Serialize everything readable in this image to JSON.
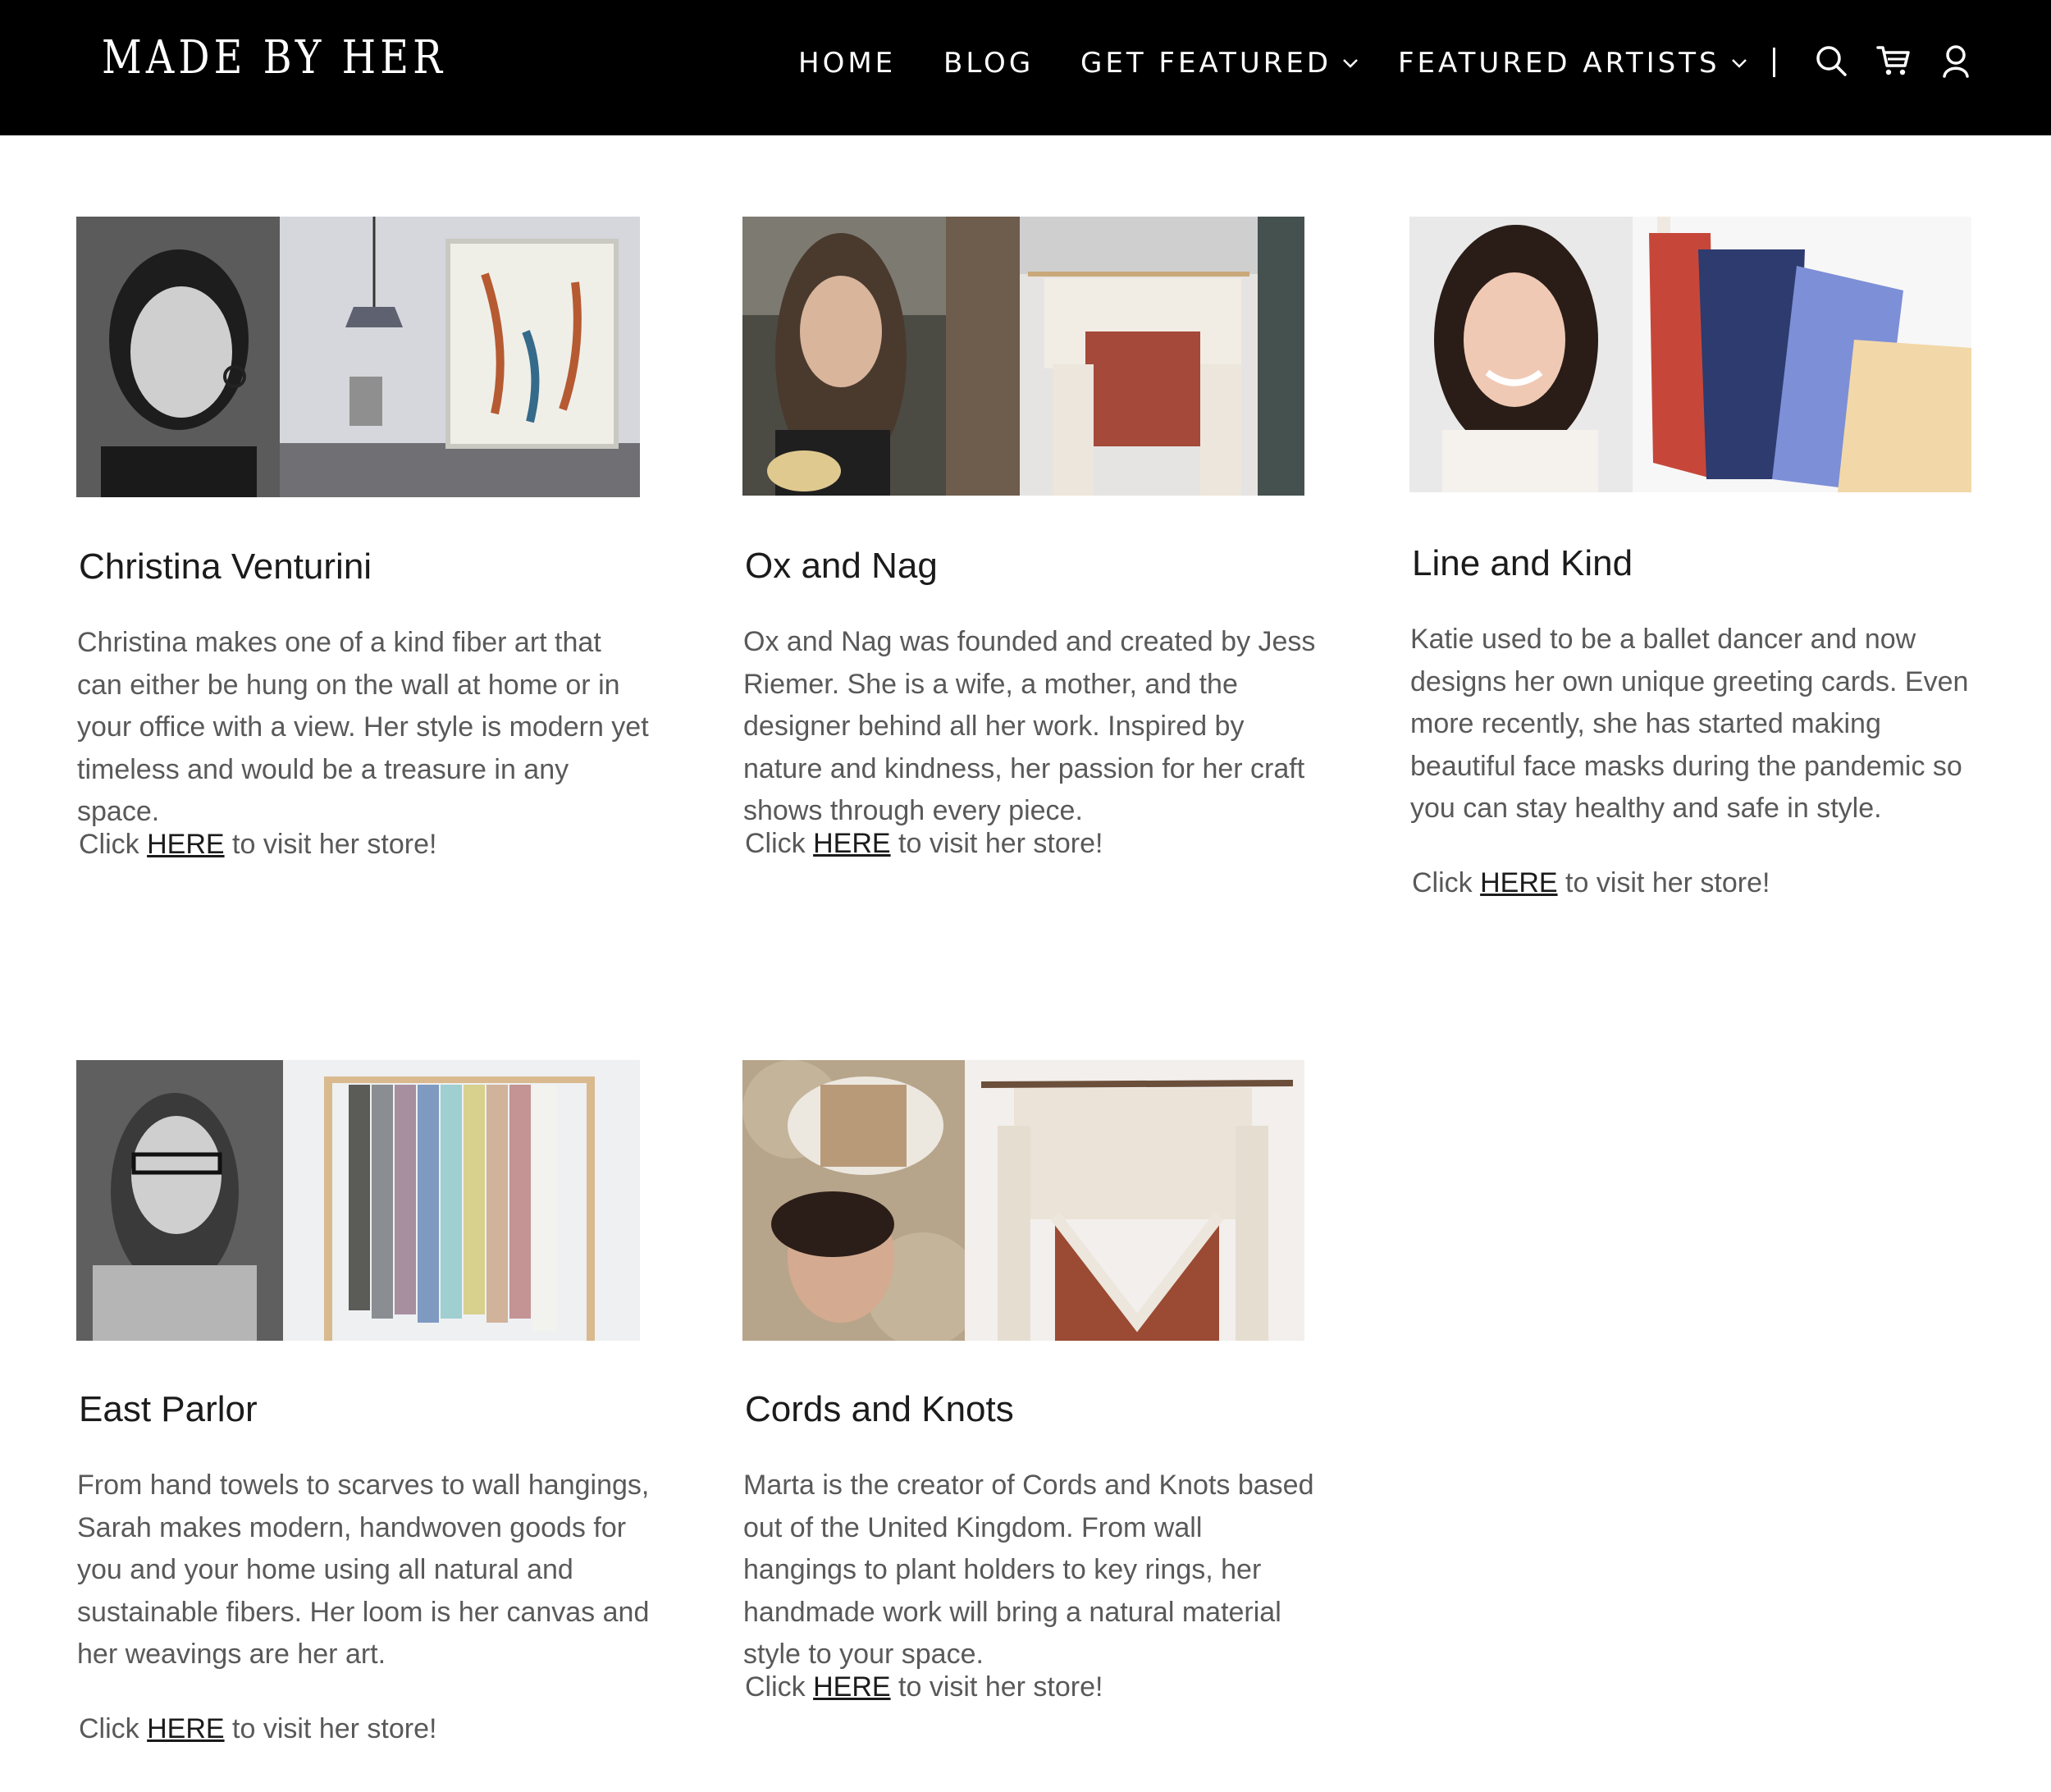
{
  "header": {
    "logo": "MADE BY HER",
    "nav": [
      {
        "label": "HOME"
      },
      {
        "label": "BLOG"
      },
      {
        "label": "GET FEATURED"
      },
      {
        "label": "FEATURED ARTISTS"
      }
    ],
    "icons": [
      "search-icon",
      "cart-icon",
      "account-icon"
    ]
  },
  "colors": {
    "header_bg": "#000000",
    "header_text": "#ffffff",
    "body_text": "#595959",
    "heading_text": "#1b1b1b"
  },
  "artists": [
    {
      "name": "Christina Venturini",
      "description": "Christina makes one of a kind fiber art that can either be hung on the wall at home or in your office with a view. Her style is modern yet timeless and would be a treasure in any space.",
      "cta_prefix": "Click ",
      "cta_link": "HERE",
      "cta_suffix": " to visit her store!"
    },
    {
      "name": "Ox and Nag",
      "description": "Ox and Nag was founded and created by Jess Riemer. She is a wife, a mother, and the designer behind all her work. Inspired by nature and kindness, her passion for her craft shows through every piece.",
      "cta_prefix": "Click ",
      "cta_link": "HERE",
      "cta_suffix": " to visit her store!"
    },
    {
      "name": "Line and Kind",
      "description": "Katie used to be a ballet dancer and now designs her own unique greeting cards. Even more recently, she has started making  beautiful face masks during the pandemic so you can stay healthy and safe in style.",
      "cta_prefix": "Click ",
      "cta_link": "HERE",
      "cta_suffix": " to visit her store!"
    },
    {
      "name": "East Parlor",
      "description": "From hand towels to scarves to wall hangings, Sarah makes modern, handwoven goods for you and your home using all natural and sustainable fibers. Her loom is her canvas and her weavings are her art.",
      "cta_prefix": "Click ",
      "cta_link": "HERE",
      "cta_suffix": " to visit her store!"
    },
    {
      "name": "Cords and Knots",
      "description": "Marta is the creator of Cords and Knots based out of the United Kingdom. From wall hangings to plant holders to key rings, her handmade work will bring a natural material style to your space.",
      "cta_prefix": "Click ",
      "cta_link": "HERE",
      "cta_suffix": " to visit her store!"
    }
  ]
}
